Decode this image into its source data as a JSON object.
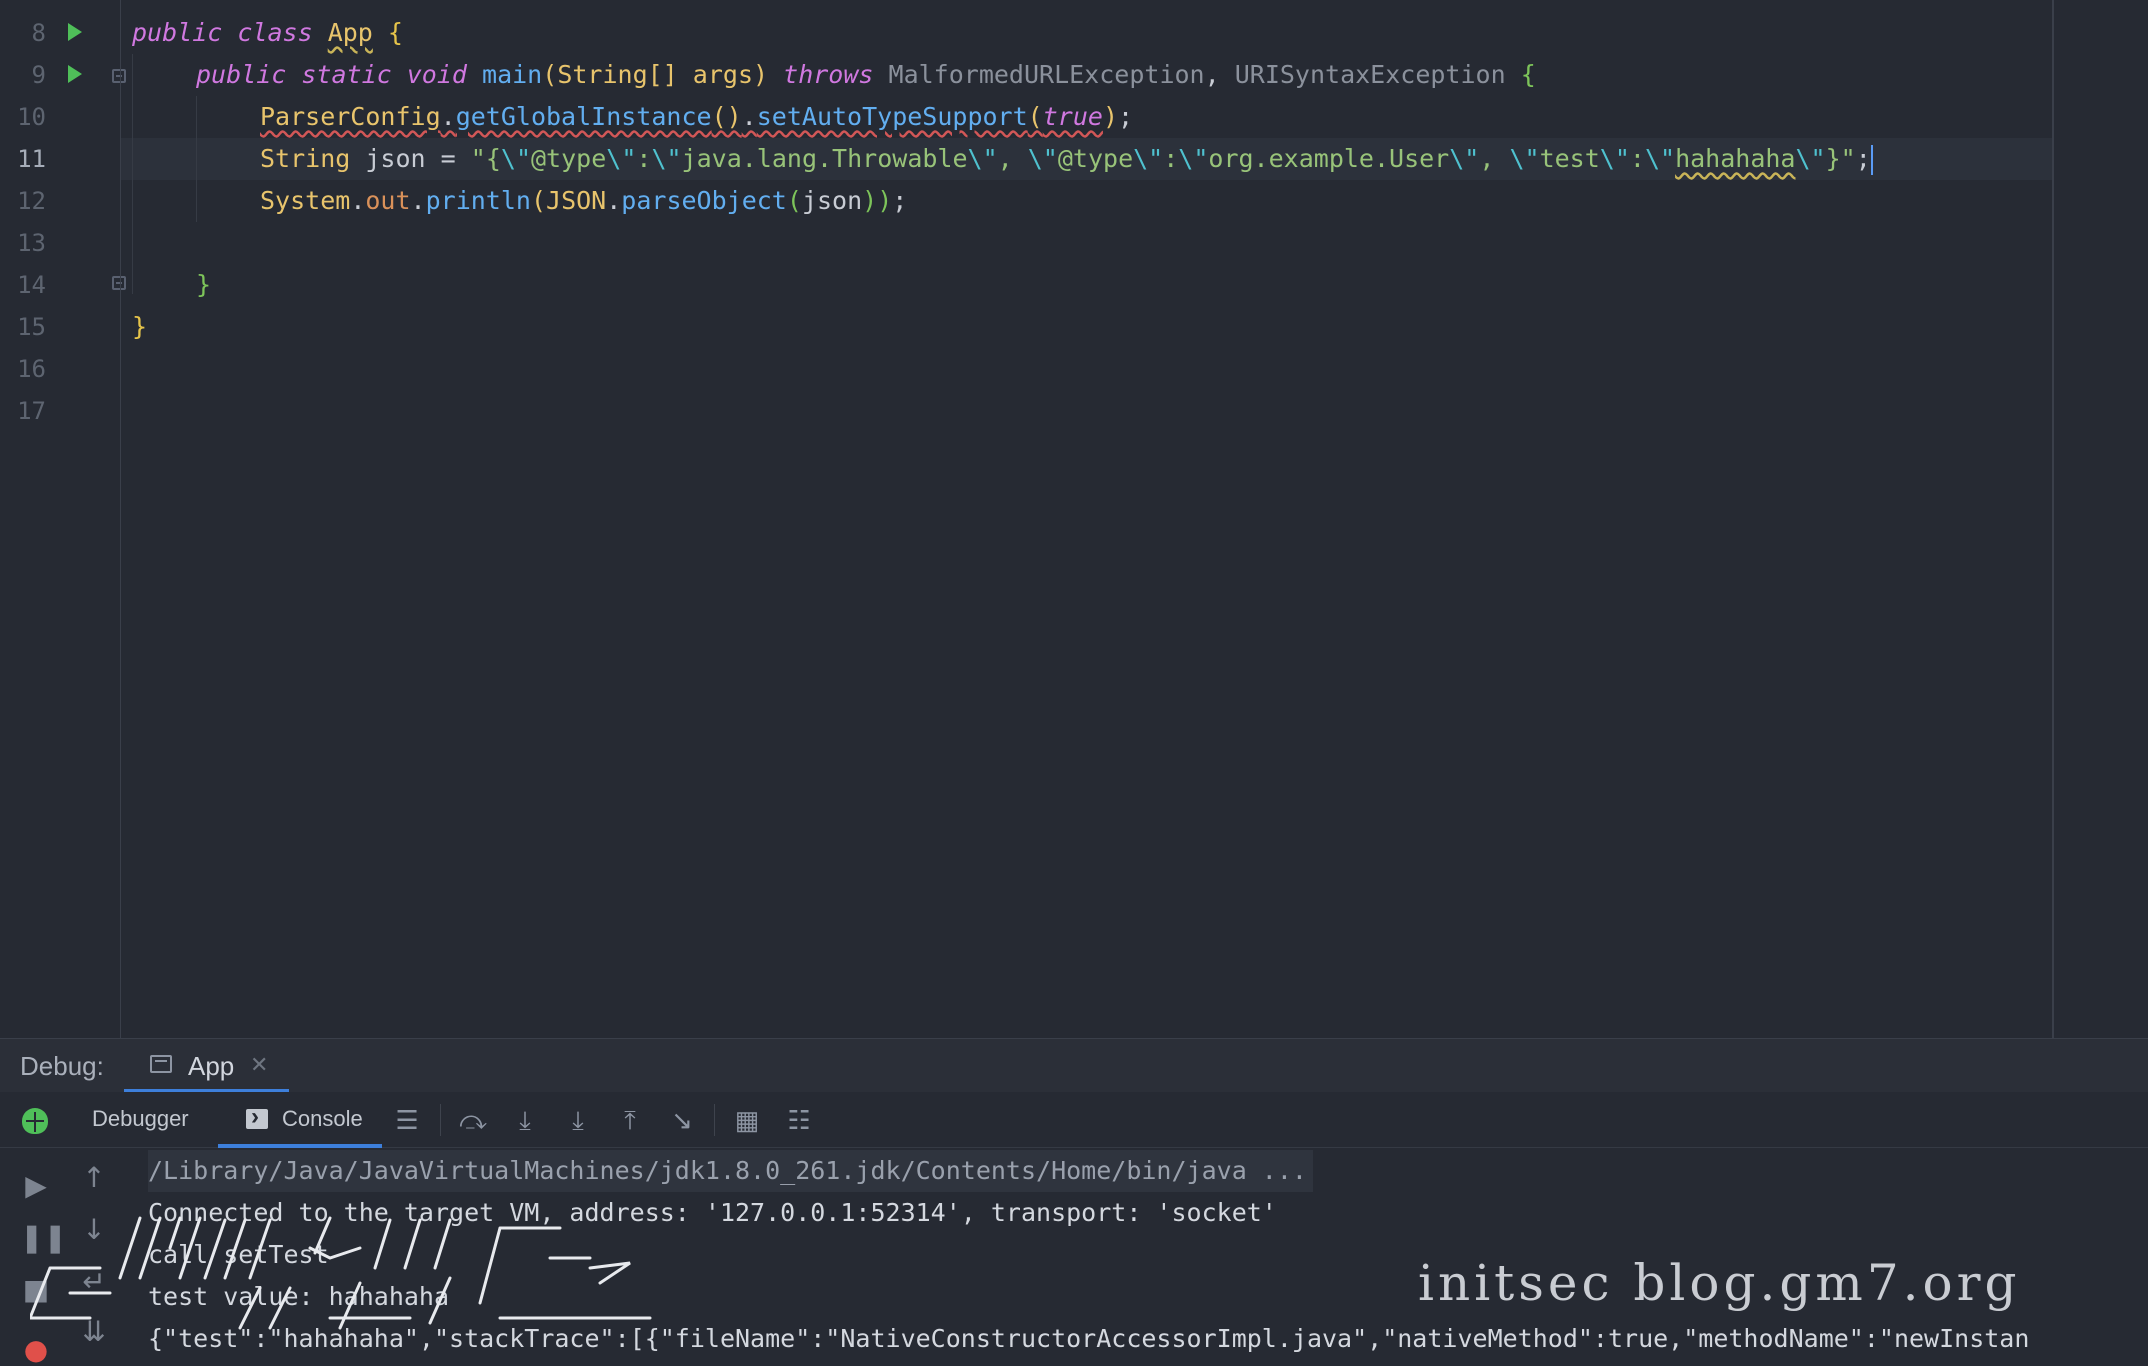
{
  "editor": {
    "line_numbers": [
      "8",
      "9",
      "10",
      "11",
      "12",
      "13",
      "14",
      "15",
      "16",
      "17"
    ],
    "current_line": "11",
    "lines": {
      "l8": {
        "kw1": "public",
        "kw2": "class",
        "cls": "App",
        "brace": "{"
      },
      "l9": {
        "kw1": "public",
        "kw2": "static",
        "kw3": "void",
        "fn": "main",
        "open": "(",
        "type": "String[]",
        "param": "args",
        "close": ")",
        "kw4": "throws",
        "ex1": "MalformedURLException",
        "comma": ",",
        "ex2": "URISyntaxException",
        "brace": "{"
      },
      "l10": {
        "cls": "ParserConfig",
        "dot1": ".",
        "fn1": "getGlobalInstance",
        "parens": "()",
        "dot2": ".",
        "fn2": "setAutoTypeSupport",
        "open": "(",
        "kw": "true",
        "close": ")",
        "semi": ";"
      },
      "l11": {
        "type": "String",
        "var": "json",
        "eq": "=",
        "s1": "\"{",
        "e1": "\\\"",
        "s2": "@type",
        "e2": "\\\"",
        "s3": ":",
        "e3": "\\\"",
        "s4": "java.lang.Throwable",
        "e4": "\\\"",
        "s5": ", ",
        "e5": "\\\"",
        "s6": "@type",
        "e6": "\\\"",
        "s7": ":",
        "e7": "\\\"",
        "s8": "org.example.User",
        "e8": "\\\"",
        "s9": ", ",
        "e9": "\\\"",
        "s10": "test",
        "e10": "\\\"",
        "s11": ":",
        "e11": "\\\"",
        "s12": "hahahaha",
        "e12": "\\\"",
        "s13": "}\"",
        "semi": ";"
      },
      "l12": {
        "cls": "System",
        "dot1": ".",
        "field": "out",
        "dot2": ".",
        "fn1": "println",
        "open1": "(",
        "cls2": "JSON",
        "dot3": ".",
        "fn2": "parseObject",
        "open2": "(",
        "arg": "json",
        "close": "))",
        "semi": ";"
      },
      "l14": {
        "brace": "}"
      },
      "l15": {
        "brace": "}"
      }
    }
  },
  "debug": {
    "label": "Debug:",
    "run_tab": "App",
    "tabs": {
      "debugger": "Debugger",
      "console": "Console"
    }
  },
  "console": {
    "lines": [
      "/Library/Java/JavaVirtualMachines/jdk1.8.0_261.jdk/Contents/Home/bin/java ...",
      "Connected to the target VM, address: '127.0.0.1:52314', transport: 'socket'",
      "call setTest",
      "test value: hahahaha",
      "{\"test\":\"hahahaha\",\"stackTrace\":[{\"fileName\":\"NativeConstructorAccessorImpl.java\",\"nativeMethod\":true,\"methodName\":\"newInstan"
    ]
  },
  "watermark": "initsec blog.gm7.org",
  "colors": {
    "background": "#262a33",
    "keyword": "#d078e0",
    "type": "#e8c46c",
    "function": "#62aef0",
    "string": "#98c379",
    "escape": "#4fc1cf",
    "accent": "#3d7fdb",
    "run_green": "#4fbf59"
  }
}
